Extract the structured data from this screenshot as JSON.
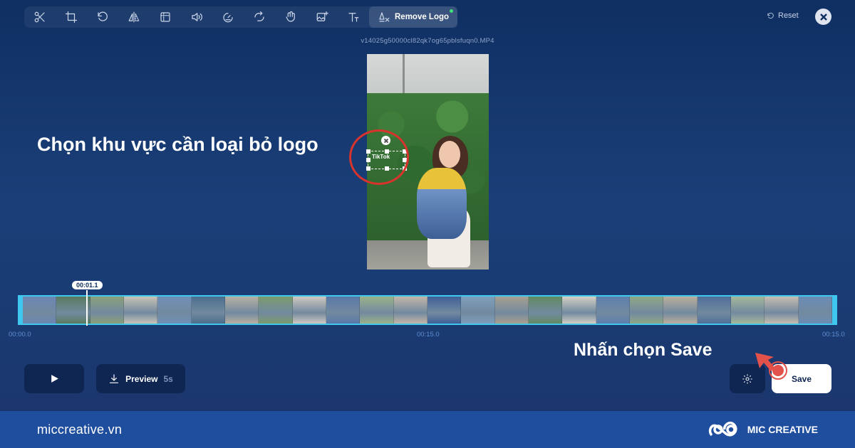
{
  "toolbar": {
    "tools": [
      {
        "icon": "scissors-icon"
      },
      {
        "icon": "crop-icon"
      },
      {
        "icon": "rotate-icon"
      },
      {
        "icon": "flip-icon"
      },
      {
        "icon": "resize-icon"
      },
      {
        "icon": "volume-icon"
      },
      {
        "icon": "speed-icon"
      },
      {
        "icon": "loop-icon"
      },
      {
        "icon": "stabilize-icon"
      },
      {
        "icon": "add-image-icon"
      },
      {
        "icon": "text-icon"
      }
    ],
    "active_tool_label": "Remove Logo",
    "reset_label": "Reset"
  },
  "video": {
    "filename": "v14025g50000cl82qk7og65pblsfuqn0.MP4",
    "watermark_text": "TikTok"
  },
  "annotations": {
    "select_area": "Chọn khu vực cần loại bỏ logo",
    "click_save": "Nhấn chọn Save"
  },
  "timeline": {
    "current_time": "00:01.1",
    "start_label": "00:00.0",
    "mid_label": "00:15.0",
    "end_label": "00:15.0",
    "frame_colors": [
      "#6c86b4",
      "#5a7a5e",
      "#8aa07a",
      "#c9c3b6",
      "#6f8fb8",
      "#4b6f8e",
      "#b8b0a2",
      "#7b9b6d",
      "#d0c8c0",
      "#5978a8",
      "#9ab28a",
      "#c4b6a8",
      "#3f6098",
      "#7e9fbd",
      "#a9a08f",
      "#628a62",
      "#d4cfc4",
      "#5d7fae",
      "#8fa886",
      "#bcae9d",
      "#4f6f9a",
      "#a5b89a",
      "#c8bdb0",
      "#6a8cb6"
    ]
  },
  "controls": {
    "preview_label": "Preview",
    "preview_duration": "5s",
    "save_label": "Save"
  },
  "brand": {
    "url": "miccreative.vn",
    "name": "MIC CREATIVE"
  }
}
